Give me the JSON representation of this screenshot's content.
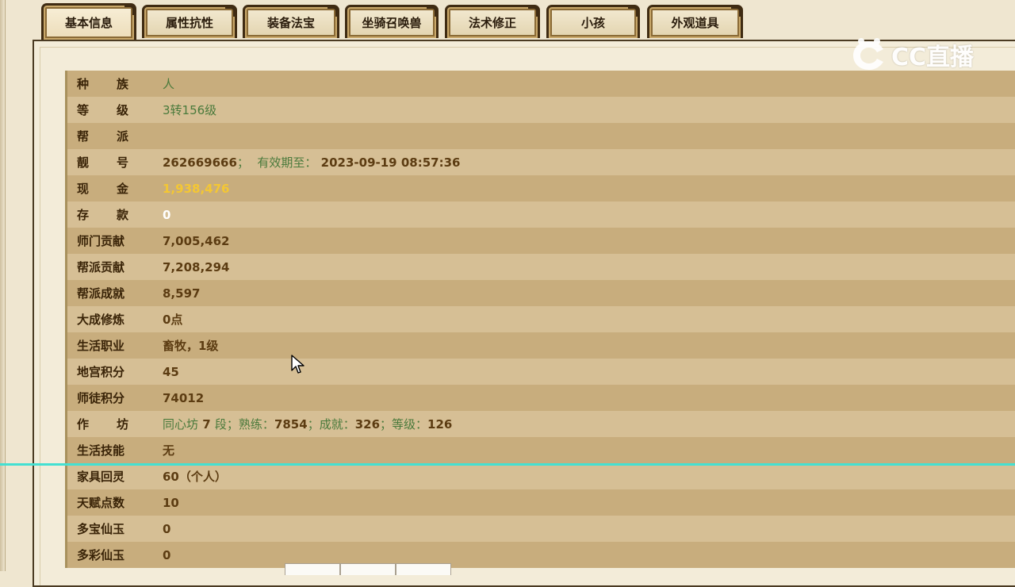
{
  "tabs": [
    {
      "label": "基本信息",
      "active": true
    },
    {
      "label": "属性抗性"
    },
    {
      "label": "装备法宝"
    },
    {
      "label": "坐骑召唤兽"
    },
    {
      "label": "法术修正"
    },
    {
      "label": "小孩"
    },
    {
      "label": "外观道具"
    }
  ],
  "watermark": {
    "text": "CC直播",
    "icon": "cc-live-logo-icon"
  },
  "rows": [
    {
      "label_a": "种",
      "label_b": "族",
      "value": "人"
    },
    {
      "label_a": "等",
      "label_b": "级",
      "value": "3转156级"
    },
    {
      "label_a": "帮",
      "label_b": "派",
      "value": ""
    },
    {
      "label_a": "靓",
      "label_b": "号",
      "value": "262669666",
      "sep": "；",
      "expiry_label": "有效期至：",
      "expiry_value": "2023-09-19 08:57:36"
    },
    {
      "label_a": "现",
      "label_b": "金",
      "value": "1,938,476"
    },
    {
      "label_a": "存",
      "label_b": "款",
      "value": "0"
    },
    {
      "label": "师门贡献",
      "value": "7,005,462"
    },
    {
      "label": "帮派贡献",
      "value": "7,208,294"
    },
    {
      "label": "帮派成就",
      "value": "8,597"
    },
    {
      "label": "大成修炼",
      "value": "0点"
    },
    {
      "label": "生活职业",
      "value": "畜牧，1级"
    },
    {
      "label": "地宫积分",
      "value": "45"
    },
    {
      "label": "师徒积分",
      "value": "74012"
    },
    {
      "label_a": "作",
      "label_b": "坊",
      "seg1": "同心坊",
      "seg2": "7",
      "seg3": "段；熟练：",
      "seg4": "7854",
      "seg5": "；成就：",
      "seg6": "326",
      "seg7": "；等级：",
      "seg8": "126"
    },
    {
      "label": "生活技能",
      "value": "无"
    },
    {
      "label": "家具回灵",
      "value": "60（个人）"
    },
    {
      "label": "天赋点数",
      "value": "10"
    },
    {
      "label": "多宝仙玉",
      "value": "0"
    },
    {
      "label": "多彩仙玉",
      "value": "0"
    }
  ],
  "colors": {
    "accent_line": "#43e0d2",
    "gold_value": "#f4c733",
    "green_value": "#4a7a3c"
  }
}
